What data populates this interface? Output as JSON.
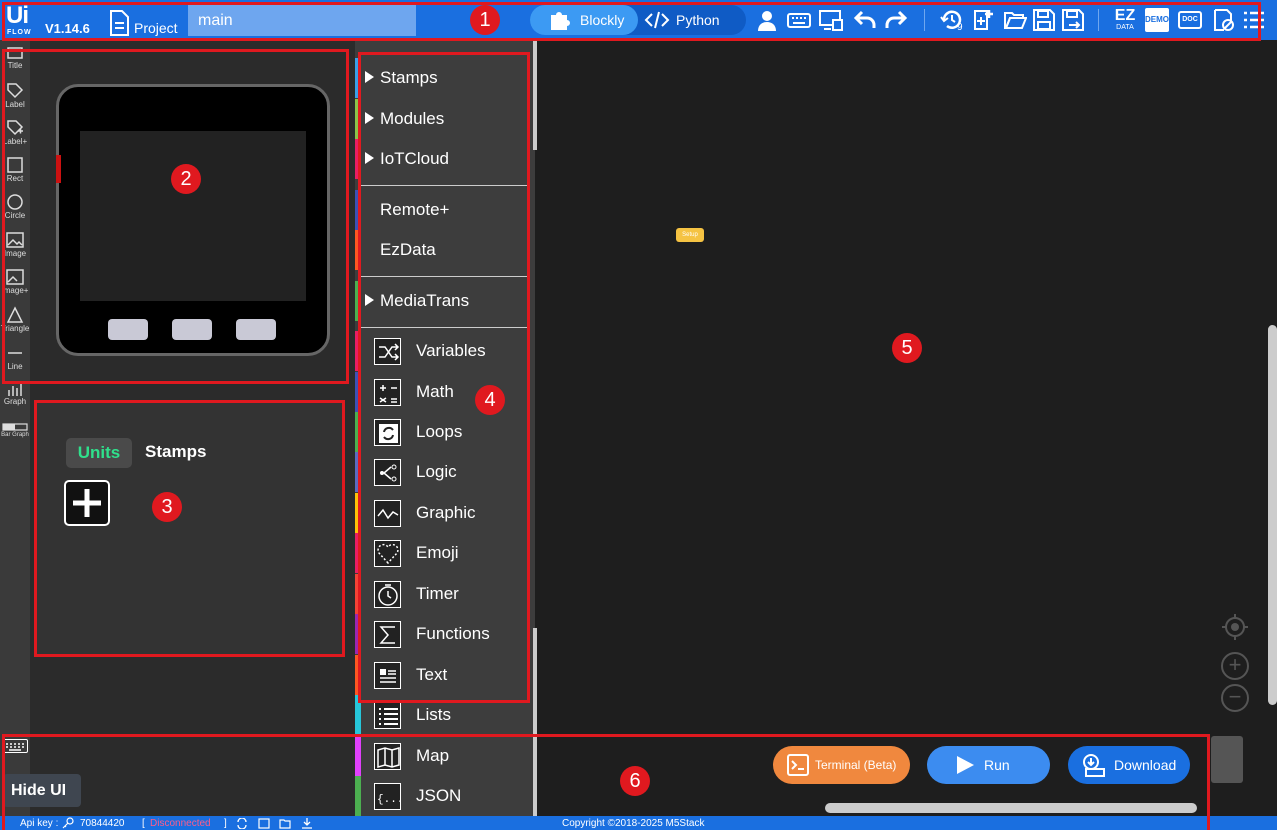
{
  "header": {
    "logo_text": "Ui",
    "logo_sub": "FLOW",
    "version": "V1.14.6",
    "project_label": "Project",
    "project_name": "main",
    "modes": [
      "Blockly",
      "Python"
    ],
    "active_mode": "Blockly",
    "icons": [
      "user-icon",
      "keyboard-icon",
      "device-icon",
      "undo-icon",
      "redo-icon",
      "history-icon",
      "new-file-icon",
      "open-folder-icon",
      "save-icon",
      "save-as-icon",
      "ezdata-icon",
      "demo-icon",
      "doc-icon",
      "settings-icon",
      "menu-icon"
    ],
    "history_count": "9",
    "ezdata_label": "EZ",
    "ezdata_sub": "DATA",
    "demo_label": "DEMO",
    "doc_label": "DOC"
  },
  "tools": [
    {
      "label": "Title",
      "icon": "title-icon"
    },
    {
      "label": "Label",
      "icon": "label-icon"
    },
    {
      "label": "Label+",
      "icon": "label-plus-icon"
    },
    {
      "label": "Rect",
      "icon": "rect-icon"
    },
    {
      "label": "Circle",
      "icon": "circle-icon"
    },
    {
      "label": "Image",
      "icon": "image-icon"
    },
    {
      "label": "Image+",
      "icon": "image-plus-icon"
    },
    {
      "label": "Triangle",
      "icon": "triangle-icon"
    },
    {
      "label": "Line",
      "icon": "line-icon"
    },
    {
      "label": "Graph",
      "icon": "graph-icon"
    },
    {
      "label": "Bar Graph",
      "icon": "bar-graph-icon"
    }
  ],
  "units_panel": {
    "tabs": [
      "Units",
      "Stamps"
    ],
    "active_tab": "Units",
    "add_icon": "plus-icon"
  },
  "categories": [
    {
      "label": "Stamps",
      "expandable": true,
      "color": "#3aa0e8"
    },
    {
      "label": "Modules",
      "expandable": true,
      "color": "#8bc34a"
    },
    {
      "label": "IoTCloud",
      "expandable": true,
      "color": "#e91e63"
    },
    {
      "label": "Remote+",
      "expandable": false,
      "color": "#3f51b5"
    },
    {
      "label": "EzData",
      "expandable": false,
      "color": "#ff5722"
    },
    {
      "label": "MediaTrans",
      "expandable": true,
      "color": "#4caf50"
    },
    {
      "label": "Variables",
      "icon": "variables-icon",
      "color": "#e91e63"
    },
    {
      "label": "Math",
      "icon": "math-icon",
      "color": "#3f51b5"
    },
    {
      "label": "Loops",
      "icon": "loops-icon",
      "color": "#4caf50"
    },
    {
      "label": "Logic",
      "icon": "logic-icon",
      "color": "#5c6bc0"
    },
    {
      "label": "Graphic",
      "icon": "graphic-icon",
      "color": "#ffc107"
    },
    {
      "label": "Emoji",
      "icon": "emoji-icon",
      "color": "#e91e63"
    },
    {
      "label": "Timer",
      "icon": "timer-icon",
      "color": "#f44336"
    },
    {
      "label": "Functions",
      "icon": "functions-icon",
      "color": "#9c27b0"
    },
    {
      "label": "Text",
      "icon": "text-icon",
      "color": "#ff5722"
    },
    {
      "label": "Lists",
      "icon": "lists-icon",
      "color": "#26c6da"
    },
    {
      "label": "Map",
      "icon": "map-icon",
      "color": "#e040fb"
    },
    {
      "label": "JSON",
      "icon": "json-icon",
      "color": "#4caf50"
    }
  ],
  "workspace": {
    "setup_block": "Setup"
  },
  "actions": {
    "terminal": "Terminal (Beta)",
    "run": "Run",
    "download": "Download",
    "hide_ui": "Hide UI"
  },
  "footer": {
    "api_key_label": "Api key :",
    "api_key_value": "70844420",
    "status": "Disconnected",
    "copyright": "Copyright ©2018-2025 M5Stack"
  },
  "annotations": [
    "1",
    "2",
    "3",
    "4",
    "5",
    "6"
  ],
  "colors": {
    "topbar": "#1a6fe0",
    "annotation": "#e0191f",
    "terminal_btn": "#f0883e",
    "run_btn": "#3c8cf0",
    "download_btn": "#1a6fe0"
  }
}
